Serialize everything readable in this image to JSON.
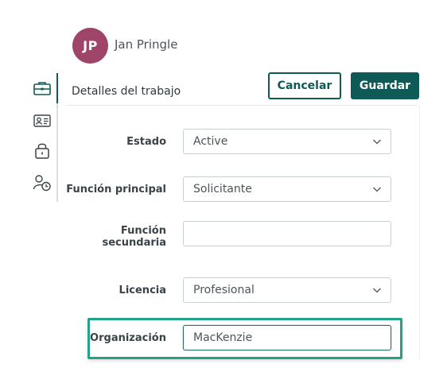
{
  "user": {
    "initials": "JP",
    "name": "Jan Pringle",
    "avatar_color": "#a0456a"
  },
  "sidebar": {
    "items": [
      {
        "icon": "briefcase-icon",
        "active": true
      },
      {
        "icon": "id-card-icon",
        "active": false
      },
      {
        "icon": "lock-icon",
        "active": false
      },
      {
        "icon": "user-clock-icon",
        "active": false
      }
    ]
  },
  "section": {
    "title": "Detalles del trabajo"
  },
  "actions": {
    "cancel_label": "Cancelar",
    "save_label": "Guardar",
    "accent_color": "#0e5a56"
  },
  "form": {
    "estado": {
      "label": "Estado",
      "value": "Active"
    },
    "funcion_principal": {
      "label": "Función principal",
      "value": "Solicitante"
    },
    "funcion_secundaria": {
      "label_line1": "Función",
      "label_line2": "secundaria",
      "value": ""
    },
    "licencia": {
      "label": "Licencia",
      "value": "Profesional"
    },
    "organizacion": {
      "label": "Organización",
      "value": "MacKenzie"
    }
  },
  "highlight_color": "#20a38a"
}
